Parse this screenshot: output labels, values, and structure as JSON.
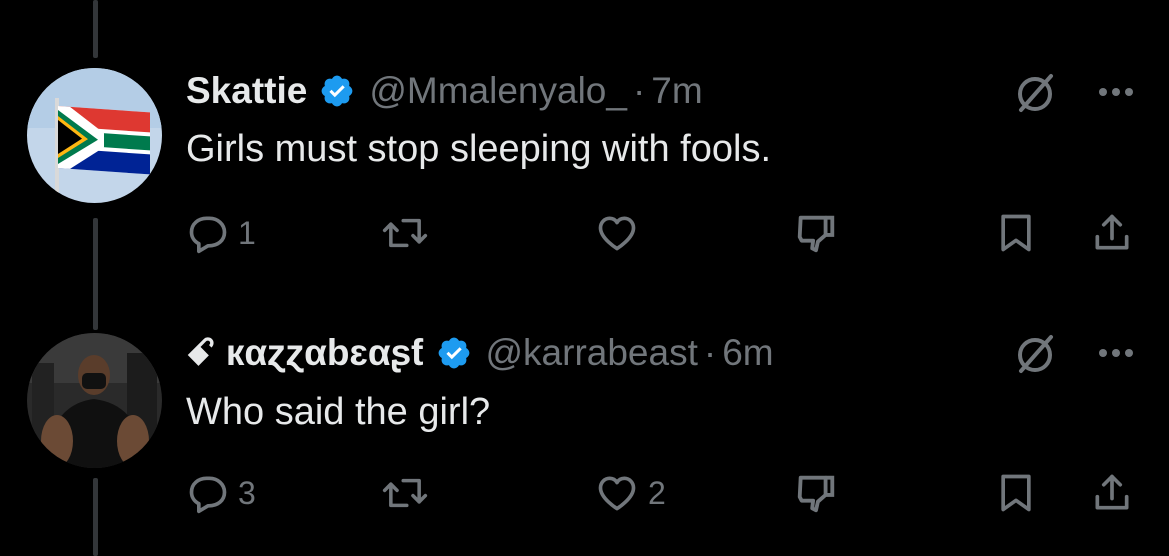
{
  "tweets": [
    {
      "name": "Skattie",
      "handle": "@Mmalenyalo_",
      "dot": "·",
      "time": "7m",
      "text": "Girls must stop sleeping with fools.",
      "avatar": "south-africa-flag-avatar",
      "verified": true,
      "replies": "1",
      "likes": ""
    },
    {
      "name": "ꗃ кαɀɀαbɛαʂƭ",
      "handle": "@karrabeast",
      "dot": "·",
      "time": "6m",
      "text": "Who said the girl?",
      "avatar": "gym-man-avatar",
      "verified": true,
      "replies": "3",
      "likes": "2"
    }
  ],
  "colors": {
    "background": "#000000",
    "primary_text": "#e7e9ea",
    "secondary_text": "#71767b",
    "verified_blue": "#1d9bf0",
    "thread_line": "#333639"
  },
  "icons": [
    "reply-icon",
    "retweet-icon",
    "like-icon",
    "downvote-icon",
    "bookmark-icon",
    "share-icon",
    "grok-icon",
    "more-icon",
    "verified-badge-icon"
  ]
}
